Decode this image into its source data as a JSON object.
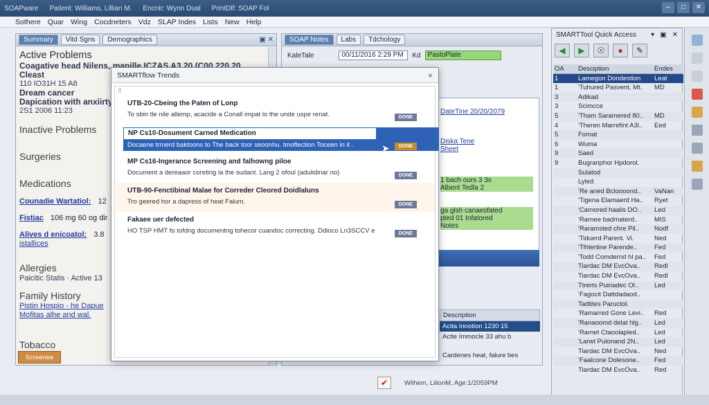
{
  "window": {
    "title_parts": [
      "SOAPware",
      "Patient: Williams, Lillian M.",
      "Encntr: Wynn Dual",
      "PrintDlf: SOAP Fol"
    ],
    "controls": [
      "–",
      "□",
      "✕"
    ]
  },
  "menu": [
    "Sothere",
    "Quar",
    "Wing",
    "Cocdneters",
    "Vdz",
    "SLAP Indes",
    "Lists",
    "New",
    "Help"
  ],
  "left_pane": {
    "tabs": [
      "Summary",
      "Vitd Sgns",
      "Demographics"
    ],
    "active_problems_header": "Active Problems",
    "active_problems": [
      "Coagative head Nilens, manille ICZAS A3 20 (C00 220 20 Cleast",
      "110 IO31H 15 A8",
      "Dream cancer",
      "Dapication with anxiirty.",
      "2S1 2006 11:23"
    ],
    "inactive_header": "Inactive Problems",
    "surgeries_header": "Surgeries",
    "medications_header": "Medications",
    "medications": [
      {
        "name": "Counadie Wartatiol:",
        "dose": "12"
      },
      {
        "name": "Fistiac",
        "dose": "106 mg 60 og dir"
      },
      {
        "name": "Alives d enicoatol:",
        "dose": "3.8"
      }
    ],
    "med_extra": "istallices",
    "allergies_header": "Allergies",
    "allergy_line": "Paicitic Statis · Active 13",
    "family_header": "Family History",
    "family_lines": [
      "Pistin Hospio - he Dapue",
      "Mofitas alhe and wal."
    ],
    "tobacco_header": "Tobacco",
    "bottom_tab": "Screenee"
  },
  "center_pane": {
    "tabs": [
      "SOAP Notes",
      "Labs",
      "Tdchology"
    ],
    "field_label": "KaleTale",
    "date_value": "00/11/2016  2:29 PM",
    "kd": "Kd",
    "status_value": "PastoPlate",
    "panel_lines": [
      "DateTine 20/20/2079",
      "Diska Tene",
      "Sheet"
    ],
    "green_lines": [
      "1 bach  ours 3 3s",
      "Albent  Tedla 2",
      "ga glsh canaesfated",
      "pted  01 Infatored",
      "Notes"
    ],
    "table_header": "Description",
    "table_rows": [
      {
        "desc": "Acita Innotion",
        "val": "1230 15"
      },
      {
        "desc": "Actle Immocle",
        "val": "33 ahu b"
      },
      {
        "desc": "Cardenes heat, falure",
        "val": "bes"
      }
    ]
  },
  "modal": {
    "title": "SMARTflow Trends",
    "close": "×",
    "items": [
      {
        "title": "UTB-20-Cbeing the Paten of Lonp",
        "desc": "To sbin tle nile allemp, acacide a Conall impat lo the unde uspe renat.",
        "btn": "DONE"
      },
      {
        "title": "NP Cs10-Dosument Carned Medication",
        "desc": "Docaene trmerd baktoons to The back toor seoonhu. tmoflection Toceen in it .",
        "btn": "DONE"
      },
      {
        "title": "MP Cs16-Ingerance Screening and falhowng piloe",
        "desc": "Document a dereaaor coreting la the sudant. Lang 2 ofoul (adulidinar no)",
        "btn": "DONE"
      },
      {
        "title": "UTB-90-Fenctibinal Malae for Correder Cleored Doidlaluns",
        "desc": "Tro geered hor a dapress of heat Falum.",
        "btn": "DONE"
      },
      {
        "title": "Fakaee uer defected",
        "desc": "HO TSP HMT fo tofdng documentng tohecor cuandoc correcting. Ddioco Ln3SCCV e",
        "btn": "DONE"
      }
    ]
  },
  "right_pane": {
    "title": "SMARTTool Quick Access",
    "header_icons": [
      "▾",
      "▣",
      "✕"
    ],
    "columns": [
      "OA",
      "Desciption",
      "Endes"
    ],
    "rows": [
      {
        "oa": "1",
        "desc": "Lamegon Dondestion",
        "code": "Leat",
        "sel": true
      },
      {
        "oa": "1",
        "desc": "'Tuhured Pasvent, Mt.",
        "code": "MD"
      },
      {
        "oa": "3",
        "desc": "Adikad",
        "code": ""
      },
      {
        "oa": "3",
        "desc": "Scimcce",
        "code": ""
      },
      {
        "oa": "5",
        "desc": "'Tham Saramered 80..",
        "code": "MD"
      },
      {
        "oa": "4",
        "desc": "'Theren Marrefint A3l..",
        "code": "Eed"
      },
      {
        "oa": "5",
        "desc": "Fornat",
        "code": ""
      },
      {
        "oa": "6",
        "desc": "Wuma",
        "code": ""
      },
      {
        "oa": "9",
        "desc": "Saed",
        "code": ""
      },
      {
        "oa": "9",
        "desc": "Bugranphor Hpdorol.",
        "code": ""
      },
      {
        "oa": "",
        "desc": "Sulatod",
        "code": ""
      },
      {
        "oa": "",
        "desc": "Lyled",
        "code": ""
      },
      {
        "oa": "",
        "desc": "'Re aned Bcloooond..",
        "code": "VaNan"
      },
      {
        "oa": "",
        "desc": "'Tigena Elamaerd Ha..",
        "code": "Ryet"
      },
      {
        "oa": "",
        "desc": "'Carnored haalis DO..",
        "code": "Led"
      },
      {
        "oa": "",
        "desc": "'Rarnee badmaterd..",
        "code": "MIS"
      },
      {
        "oa": "",
        "desc": "'Raramsted chre Pil..",
        "code": "Nodf"
      },
      {
        "oa": "",
        "desc": "'Tiduerd Parent. Vi.",
        "code": "Ned"
      },
      {
        "oa": "",
        "desc": "'Tlhtertine Parende..",
        "code": "Fed"
      },
      {
        "oa": "",
        "desc": "'Todd Comdernd hl pa..",
        "code": "Fed"
      },
      {
        "oa": "",
        "desc": "Tiardac DM EvcOva..",
        "code": "Redl"
      },
      {
        "oa": "",
        "desc": "Tiardac DM EvcOva..",
        "code": "Redl"
      },
      {
        "oa": "",
        "desc": "Ttrerts Puiriadec Ol..",
        "code": "Led"
      },
      {
        "oa": "",
        "desc": "'Fagocit Dattdadaod..",
        "code": ""
      },
      {
        "oa": "",
        "desc": "Tadtites Paructol.",
        "code": ""
      },
      {
        "oa": "",
        "desc": "'Ramarred Gone Levi..",
        "code": "Red"
      },
      {
        "oa": "",
        "desc": "'Ranaoomd delat hlg..",
        "code": "Led"
      },
      {
        "oa": "",
        "desc": "'Rarnet Ctaoolapled..",
        "code": "Led"
      },
      {
        "oa": "",
        "desc": "'Larwt Pulonand 2N..",
        "code": "Led"
      },
      {
        "oa": "",
        "desc": "Tiardac DM EvcOva..",
        "code": "Ned"
      },
      {
        "oa": "",
        "desc": "'Faalcone Dolesone..",
        "code": "Fed"
      },
      {
        "oa": "",
        "desc": "Tiardac DM EvcOva..",
        "code": "Red"
      }
    ]
  },
  "status": {
    "text": "Wilhem, LilionM, Age:1/2059PM"
  }
}
